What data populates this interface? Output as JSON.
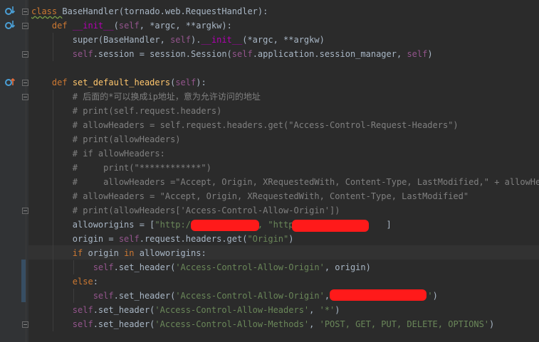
{
  "editor": {
    "lines": [
      {
        "id": "l1",
        "tokens": [
          [
            "kw",
            "class "
          ],
          [
            "cls",
            "BaseHandler"
          ],
          [
            "p",
            "(tornado.web.RequestHandler):"
          ]
        ]
      },
      {
        "id": "l2",
        "tokens": [
          [
            "p",
            "    "
          ],
          [
            "kw",
            "def "
          ],
          [
            "magic",
            "__init__"
          ],
          [
            "p",
            "("
          ],
          [
            "self",
            "self"
          ],
          [
            "p",
            ", *argc, **"
          ],
          [
            "p",
            "argkw"
          ],
          [
            "p",
            "):"
          ]
        ]
      },
      {
        "id": "l3",
        "tokens": [
          [
            "p",
            "        super(BaseHandler, "
          ],
          [
            "self",
            "self"
          ],
          [
            "p",
            ")."
          ],
          [
            "magic",
            "__init__"
          ],
          [
            "p",
            "(*argc, **argkw)"
          ]
        ]
      },
      {
        "id": "l4",
        "tokens": [
          [
            "p",
            "        "
          ],
          [
            "self",
            "self"
          ],
          [
            "p",
            ".session = session.Session("
          ],
          [
            "self",
            "self"
          ],
          [
            "p",
            ".application.session_manager, "
          ],
          [
            "self",
            "self"
          ],
          [
            "p",
            ")"
          ]
        ]
      },
      {
        "id": "l5",
        "tokens": [
          [
            "p",
            ""
          ]
        ]
      },
      {
        "id": "l6",
        "tokens": [
          [
            "p",
            "    "
          ],
          [
            "kw",
            "def "
          ],
          [
            "fn",
            "set_default_headers"
          ],
          [
            "p",
            "("
          ],
          [
            "self",
            "self"
          ],
          [
            "p",
            "):"
          ]
        ]
      },
      {
        "id": "l7",
        "tokens": [
          [
            "cm",
            "        # 后面的*可以换成ip地址，意为允许访问的地址"
          ]
        ]
      },
      {
        "id": "l8",
        "tokens": [
          [
            "cm",
            "        # print(self.request.headers)"
          ]
        ]
      },
      {
        "id": "l9",
        "tokens": [
          [
            "cm",
            "        # allowHeaders = self.request.headers.get(\"Access-Control-Request-Headers\")"
          ]
        ]
      },
      {
        "id": "l10",
        "tokens": [
          [
            "cm",
            "        # print(allowHeaders)"
          ]
        ]
      },
      {
        "id": "l11",
        "tokens": [
          [
            "cm",
            "        # if allowHeaders:"
          ]
        ]
      },
      {
        "id": "l12",
        "tokens": [
          [
            "cm",
            "        #     print(\"************\")"
          ]
        ]
      },
      {
        "id": "l13",
        "tokens": [
          [
            "cm",
            "        #     allowHeaders =\"Accept, Origin, XRequestedWith, Content-Type, LastModified,\" + allowHeade"
          ]
        ]
      },
      {
        "id": "l14",
        "tokens": [
          [
            "cm",
            "        # allowHeaders = \"Accept, Origin, XRequestedWith, Content-Type, LastModified\""
          ]
        ]
      },
      {
        "id": "l15",
        "tokens": [
          [
            "cm",
            "        # print(allowHeaders['Access-Control-Allow-Origin'])"
          ]
        ]
      },
      {
        "id": "l16",
        "tokens": [
          [
            "p",
            "        allowor"
          ],
          [
            "p",
            "igins = ["
          ],
          [
            "str",
            "\"http://"
          ],
          [
            "p",
            "            "
          ],
          [
            "str",
            ", \"http"
          ],
          [
            "p",
            "                  "
          ],
          [
            "p",
            "]"
          ]
        ]
      },
      {
        "id": "l17",
        "tokens": [
          [
            "p",
            "        origin = "
          ],
          [
            "self",
            "self"
          ],
          [
            "p",
            ".request.headers.get("
          ],
          [
            "str",
            "\"Origin\""
          ],
          [
            "p",
            ")"
          ]
        ]
      },
      {
        "id": "l18",
        "tokens": [
          [
            "p",
            "        "
          ],
          [
            "kw",
            "if "
          ],
          [
            "p",
            "origin "
          ],
          [
            "kw",
            "in "
          ],
          [
            "p",
            "alloworigins:"
          ]
        ]
      },
      {
        "id": "l19",
        "tokens": [
          [
            "p",
            "            "
          ],
          [
            "self",
            "self"
          ],
          [
            "p",
            ".set_header("
          ],
          [
            "str",
            "'Access-Control-Allow-Origin'"
          ],
          [
            "p",
            ", origin)"
          ]
        ]
      },
      {
        "id": "l20",
        "tokens": [
          [
            "p",
            "        "
          ],
          [
            "kw",
            "else"
          ],
          [
            "p",
            ":"
          ]
        ]
      },
      {
        "id": "l21",
        "tokens": [
          [
            "p",
            "            "
          ],
          [
            "self",
            "self"
          ],
          [
            "p",
            ".set_header("
          ],
          [
            "str",
            "'Access-Control-Allow-Origin'"
          ],
          [
            "p",
            ", "
          ],
          [
            "str",
            "'"
          ],
          [
            "p",
            "                 "
          ],
          [
            "str",
            "'"
          ],
          [
            "p",
            ")"
          ]
        ]
      },
      {
        "id": "l22",
        "tokens": [
          [
            "p",
            "        "
          ],
          [
            "self",
            "self"
          ],
          [
            "p",
            ".set_header("
          ],
          [
            "str",
            "'Access-Control-Allow-Headers'"
          ],
          [
            "p",
            ", "
          ],
          [
            "str",
            "'*'"
          ],
          [
            "p",
            ")"
          ]
        ]
      },
      {
        "id": "l23",
        "tokens": [
          [
            "p",
            "        "
          ],
          [
            "self",
            "self"
          ],
          [
            "p",
            ".set_header("
          ],
          [
            "str",
            "'Access-Control-Allow-Methods'"
          ],
          [
            "p",
            ", "
          ],
          [
            "str",
            "'POST, GET, PUT, DELETE, OPTIONS'"
          ],
          [
            "p",
            ")"
          ]
        ]
      }
    ],
    "colors": {
      "background": "#2b2b2b",
      "gutter": "#313335",
      "keyword": "#cc7832",
      "self": "#94558d",
      "string": "#6a8759",
      "comment": "#808080",
      "function": "#ffc66d",
      "magic": "#b200b2",
      "redaction": "#ff1a1a"
    },
    "gutter_icons": [
      {
        "name": "override-icon",
        "line": "l1"
      },
      {
        "name": "override-icon",
        "line": "l2"
      },
      {
        "name": "override-up-icon",
        "line": "l6"
      }
    ]
  }
}
